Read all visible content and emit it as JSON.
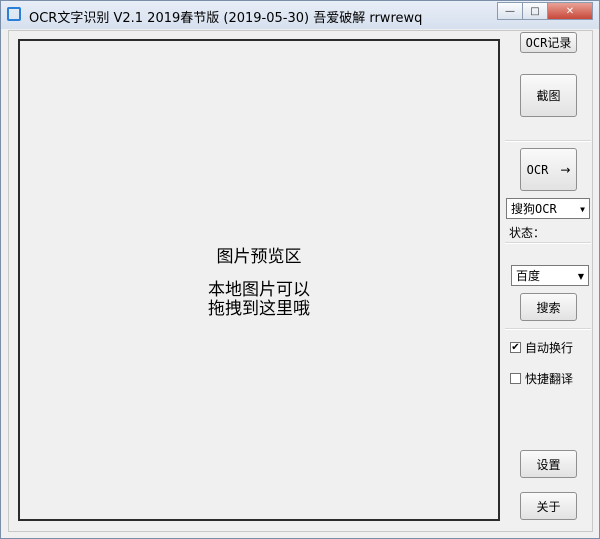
{
  "window": {
    "title": "OCR文字识别 V2.1    2019春节版 (2019-05-30)    吾爱破解 rrwrewq",
    "minimize": "—",
    "maximize": "□",
    "close": "✕"
  },
  "preview": {
    "title": "图片预览区",
    "hint_line1": "本地图片可以",
    "hint_line2": "拖拽到这里哦"
  },
  "sidebar": {
    "ocr_history_label": "OCR记录",
    "screenshot_label": "截图",
    "ocr_label": "OCR",
    "ocr_arrow": "→",
    "engine_selected": "搜狗OCR",
    "status_label": "状态：",
    "search_engine_selected": "百度",
    "search_label": "搜索",
    "auto_wrap_label": "自动换行",
    "auto_wrap_checked": true,
    "quick_translate_label": "快捷翻译",
    "quick_translate_checked": false,
    "settings_label": "设置",
    "about_label": "关于"
  }
}
